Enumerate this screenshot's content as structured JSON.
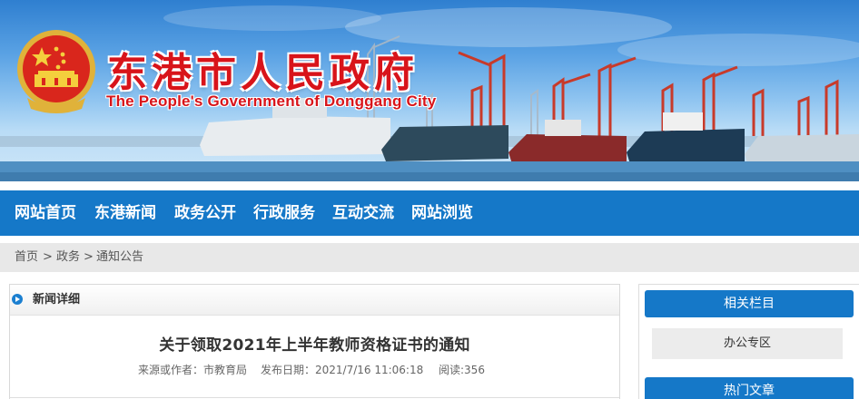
{
  "site": {
    "title": "东港市人民政府",
    "subtitle": "The People's Government of Donggang City"
  },
  "nav": {
    "items": [
      "网站首页",
      "东港新闻",
      "政务公开",
      "行政服务",
      "互动交流",
      "网站浏览"
    ]
  },
  "breadcrumb": {
    "items": [
      "首页",
      "政务",
      "通知公告"
    ],
    "separator": ">"
  },
  "article": {
    "section_label": "新闻详细",
    "title": "关于领取2021年上半年教师资格证书的通知",
    "source": "来源或作者：市教育局",
    "date": "发布日期：2021/7/16 11:06:18",
    "views": "阅读:356"
  },
  "sidebar": {
    "related_header": "相关栏目",
    "related_link": "办公专区",
    "hot_header": "热门文章"
  },
  "colors": {
    "nav_blue": "#1578c8",
    "title_red": "#d8141a",
    "breadcrumb_bg": "#e8e8e8"
  }
}
